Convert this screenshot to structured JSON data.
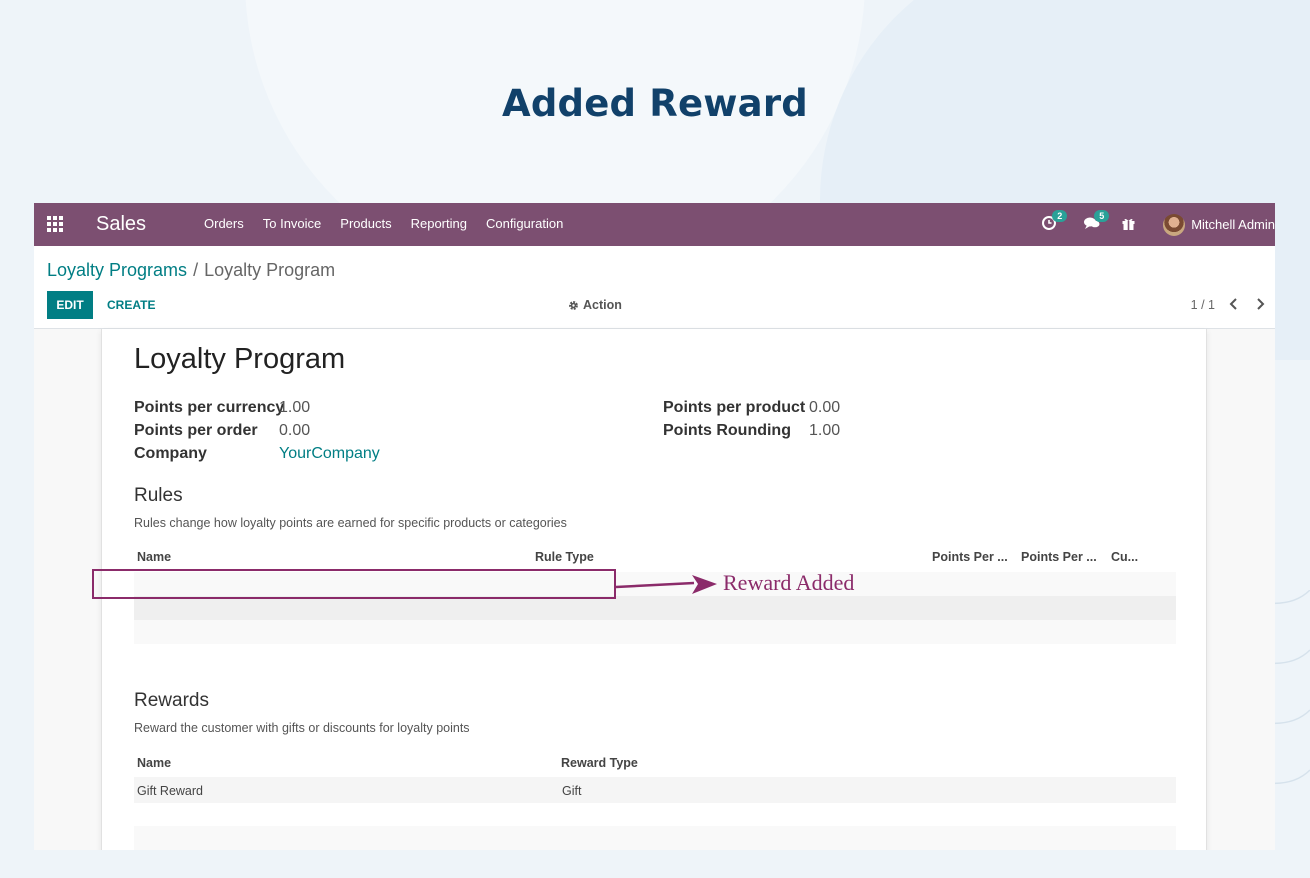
{
  "page_heading": "Added Reward",
  "navbar": {
    "app_name": "Sales",
    "menu": [
      "Orders",
      "To Invoice",
      "Products",
      "Reporting",
      "Configuration"
    ],
    "activity_count": "2",
    "messages_count": "5",
    "user_name": "Mitchell Admin",
    "color": "#7c4f71"
  },
  "breadcrumb": {
    "parent": "Loyalty Programs",
    "separator": "/",
    "current": "Loyalty Program"
  },
  "buttons": {
    "edit": "EDIT",
    "create": "CREATE",
    "action": "Action"
  },
  "pager": {
    "value": "1 / 1"
  },
  "record": {
    "title": "Loyalty Program",
    "fields_left": [
      {
        "label": "Points per currency",
        "value": "1.00"
      },
      {
        "label": "Points per order",
        "value": "0.00"
      },
      {
        "label": "Company",
        "value": "YourCompany"
      }
    ],
    "fields_right": [
      {
        "label": "Points per product",
        "value": "0.00"
      },
      {
        "label": "Points Rounding",
        "value": "1.00"
      }
    ]
  },
  "rules": {
    "title": "Rules",
    "help": "Rules change how loyalty points are earned for specific products or categories",
    "columns": [
      "Name",
      "Rule Type",
      "Points Per ...",
      "Points Per ...",
      "Cu..."
    ]
  },
  "rewards": {
    "title": "Rewards",
    "help": "Reward the customer with gifts or discounts for loyalty points",
    "columns": [
      "Name",
      "Reward Type"
    ],
    "rows": [
      {
        "name": "Gift Reward",
        "type": "Gift"
      }
    ]
  },
  "annotation": {
    "label": "Reward Added",
    "color": "#8b2b6a"
  }
}
